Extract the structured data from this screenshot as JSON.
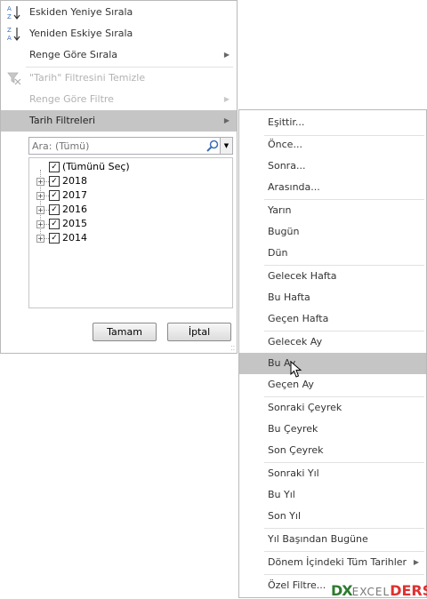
{
  "filter_menu": {
    "items": [
      {
        "label": "Eskiden Yeniye Sırala",
        "icon": "sort-asc-icon",
        "disabled": false
      },
      {
        "label": "Yeniden Eskiye Sırala",
        "icon": "sort-desc-icon",
        "disabled": false
      },
      {
        "label": "Renge Göre Sırala",
        "disabled": false,
        "submenu": true
      },
      {
        "label": "\"Tarih\" Filtresini Temizle",
        "icon": "clear-filter-icon",
        "disabled": true
      },
      {
        "label": "Renge Göre Filtre",
        "disabled": true,
        "submenu": true
      },
      {
        "label": "Tarih Filtreleri",
        "disabled": false,
        "submenu": true,
        "highlighted": true
      }
    ],
    "search": {
      "placeholder": "Ara: (Tümü)"
    },
    "tree": [
      {
        "label": "(Tümünü Seç)",
        "checked": true
      },
      {
        "label": "2018",
        "checked": true
      },
      {
        "label": "2017",
        "checked": true
      },
      {
        "label": "2016",
        "checked": true
      },
      {
        "label": "2015",
        "checked": true
      },
      {
        "label": "2014",
        "checked": true
      }
    ],
    "ok_label": "Tamam",
    "cancel_label": "İptal"
  },
  "date_filters_submenu": {
    "items": [
      {
        "label": "Eşittir..."
      },
      {
        "label": "Önce..."
      },
      {
        "label": "Sonra..."
      },
      {
        "label": "Arasında..."
      },
      {
        "label": "Yarın"
      },
      {
        "label": "Bugün"
      },
      {
        "label": "Dün"
      },
      {
        "label": "Gelecek Hafta"
      },
      {
        "label": "Bu Hafta"
      },
      {
        "label": "Geçen Hafta"
      },
      {
        "label": "Gelecek Ay"
      },
      {
        "label": "Bu Ay",
        "highlighted": true
      },
      {
        "label": "Geçen Ay"
      },
      {
        "label": "Sonraki Çeyrek"
      },
      {
        "label": "Bu Çeyrek"
      },
      {
        "label": "Son Çeyrek"
      },
      {
        "label": "Sonraki Yıl"
      },
      {
        "label": "Bu Yıl"
      },
      {
        "label": "Son Yıl"
      },
      {
        "label": "Yıl Başından Bugüne"
      },
      {
        "label": "Dönem İçindeki Tüm Tarihler",
        "submenu": true
      },
      {
        "label": "Özel Filtre..."
      }
    ]
  },
  "watermark": {
    "part1": "DX",
    "part2": "EXCEL",
    "part3": "DERS"
  },
  "colors": {
    "highlight": "#c5c5c5",
    "menu_border": "#b9b9b9",
    "disabled_text": "#b2b2b2"
  }
}
